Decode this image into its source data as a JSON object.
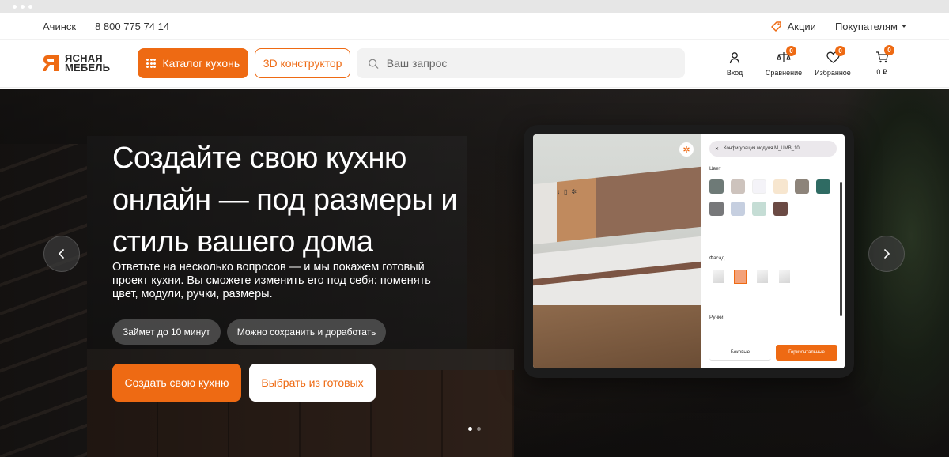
{
  "topbar": {
    "city": "Ачинск",
    "phone": "8 800 775 74 14",
    "promo": "Акции",
    "buyers": "Покупателям"
  },
  "header": {
    "logo_line1": "ЯСНАЯ",
    "logo_line2": "МЕБЕЛЬ",
    "catalog_label": "Каталог кухонь",
    "constructor_label": "3D конструктор",
    "search_placeholder": "Ваш запрос",
    "actions": [
      {
        "label": "Вход",
        "icon": "user-icon"
      },
      {
        "label": "Сравнение",
        "icon": "compare-icon",
        "count": "0"
      },
      {
        "label": "Избранное",
        "icon": "heart-icon",
        "count": "0"
      },
      {
        "label": "0 ₽",
        "icon": "cart-icon",
        "count": "0"
      }
    ]
  },
  "hero": {
    "title": "Создайте свою кухню онлайн — под размеры и стиль вашего дома",
    "description": "Ответьте на несколько вопросов — и мы покажем готовый проект кухни. Вы сможете изменить его под себя: поменять цвет, модули, ручки, размеры.",
    "chips": [
      "Займет до 10 минут",
      "Можно сохранить и доработать"
    ],
    "cta_primary": "Создать свою кухню",
    "cta_secondary": "Выбрать из готовых",
    "slides_total": 2,
    "slide_active": 1
  },
  "configurator": {
    "module_label": "Конфигурация модуля M_UMB_10",
    "color_label": "Цвет",
    "facade_label": "Фасад",
    "handles_label": "Ручки",
    "handle_options": [
      "Боковые",
      "Горизонтальные"
    ],
    "handle_selected": "Горизонтальные",
    "swatches": [
      "#6e7a77",
      "#cdc3bd",
      "#f4f3f8",
      "#f7e6cf",
      "#8d847a",
      "#2f6b63",
      "#77787a",
      "#c6cfe0",
      "#c5ddd5",
      "#6b4a44"
    ]
  },
  "colors": {
    "accent": "#ee6a13"
  }
}
